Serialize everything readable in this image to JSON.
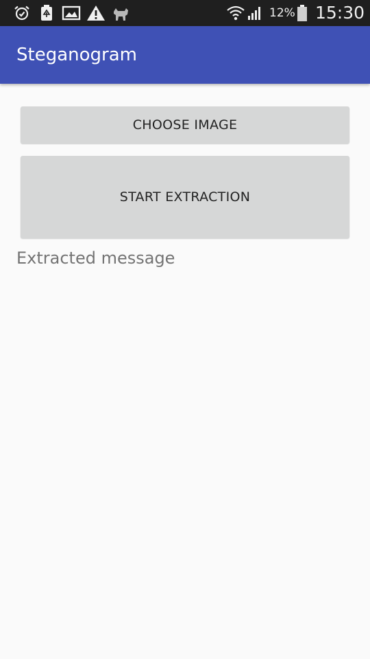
{
  "status_bar": {
    "notification_icons": [
      "alarm-icon",
      "recycle-icon",
      "image-icon",
      "warning-icon",
      "animal-icon"
    ],
    "system_icons": [
      "wifi-icon",
      "signal-icon",
      "battery-icon"
    ],
    "battery_percent": "12%",
    "time": "15:30"
  },
  "app_bar": {
    "title": "Steganogram",
    "color": "#3f51b5"
  },
  "main": {
    "choose_image_label": "CHOOSE IMAGE",
    "start_extraction_label": "START EXTRACTION",
    "extracted_message_label": "Extracted message"
  },
  "colors": {
    "button_bg": "#d6d7d7",
    "background": "#fafafa",
    "status_bar_bg": "#1f1f1f"
  }
}
